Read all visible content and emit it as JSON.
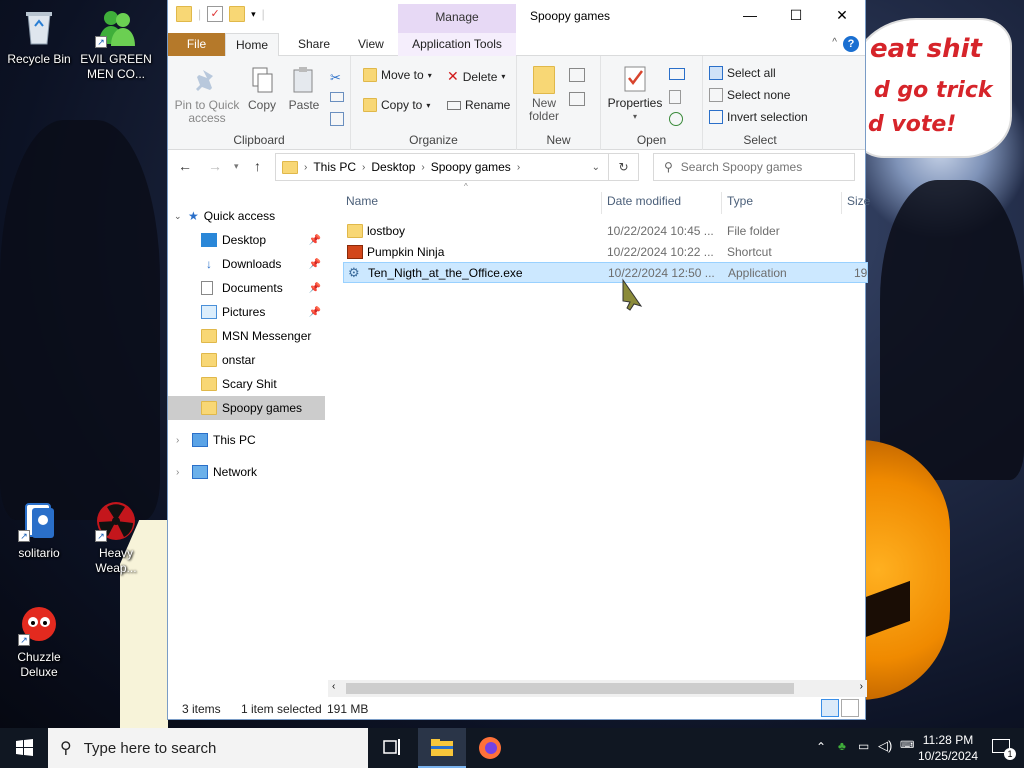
{
  "desktop": {
    "icons": [
      {
        "label": "Recycle Bin"
      },
      {
        "label": "EVIL GREEN MEN CO..."
      },
      {
        "label": "solitario"
      },
      {
        "label": "Heavy Weap..."
      },
      {
        "label": "Chuzzle Deluxe"
      }
    ],
    "wallpaper_text": [
      "eat shit",
      "d go trick",
      "d vote!"
    ]
  },
  "explorer": {
    "title": "Spoopy games",
    "manage_tab": "Manage",
    "tabs": {
      "file": "File",
      "home": "Home",
      "share": "Share",
      "view": "View",
      "app_tools": "Application Tools"
    },
    "ribbon": {
      "clipboard": {
        "label": "Clipboard",
        "pin": "Pin to Quick access",
        "copy": "Copy",
        "paste": "Paste"
      },
      "organize": {
        "label": "Organize",
        "move_to": "Move to",
        "copy_to": "Copy to",
        "delete": "Delete",
        "rename": "Rename"
      },
      "new": {
        "label": "New",
        "new_folder": "New folder"
      },
      "open": {
        "label": "Open",
        "properties": "Properties"
      },
      "select": {
        "label": "Select",
        "select_all": "Select all",
        "select_none": "Select none",
        "invert": "Invert selection"
      }
    },
    "address": {
      "segments": [
        "This PC",
        "Desktop",
        "Spoopy games"
      ],
      "search_placeholder": "Search Spoopy games"
    },
    "nav": {
      "quick_access": "Quick access",
      "items": [
        {
          "label": "Desktop",
          "pinned": true
        },
        {
          "label": "Downloads",
          "pinned": true
        },
        {
          "label": "Documents",
          "pinned": true
        },
        {
          "label": "Pictures",
          "pinned": true
        },
        {
          "label": "MSN Messenger"
        },
        {
          "label": "onstar"
        },
        {
          "label": "Scary Shit"
        },
        {
          "label": "Spoopy games"
        }
      ],
      "this_pc": "This PC",
      "network": "Network"
    },
    "columns": {
      "name": "Name",
      "date": "Date modified",
      "type": "Type",
      "size": "Size"
    },
    "files": [
      {
        "name": "lostboy",
        "date": "10/22/2024 10:45 ...",
        "type": "File folder",
        "size": ""
      },
      {
        "name": "Pumpkin Ninja",
        "date": "10/22/2024 10:22 ...",
        "type": "Shortcut",
        "size": ""
      },
      {
        "name": "Ten_Nigth_at_the_Office.exe",
        "date": "10/22/2024 12:50 ...",
        "type": "Application",
        "size": "19"
      }
    ],
    "status": {
      "count": "3 items",
      "selected": "1 item selected",
      "size": "191 MB"
    }
  },
  "taskbar": {
    "search_placeholder": "Type here to search",
    "time": "11:28 PM",
    "date": "10/25/2024",
    "notifications": "1"
  }
}
